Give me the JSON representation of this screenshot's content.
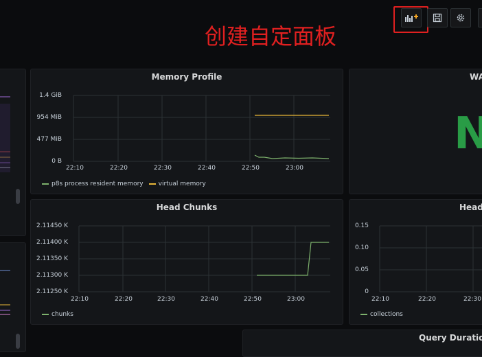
{
  "annotation": "创建自定面板",
  "toolbar": {
    "add_panel_icon": "add-panel-icon",
    "save_icon": "save-icon",
    "settings_icon": "gear-icon"
  },
  "colors": {
    "green": "#7eb26d",
    "yellow": "#eab839",
    "red": "#e02020",
    "stat_green": "#299c46"
  },
  "panels": {
    "memory": {
      "title": "Memory Profile",
      "yticks": [
        "1.4 GiB",
        "954 MiB",
        "477 MiB",
        "0 B"
      ],
      "xticks": [
        "22:10",
        "22:20",
        "22:30",
        "22:40",
        "22:50",
        "23:00"
      ],
      "legend": [
        "p8s process resident memory",
        "virtual memory"
      ]
    },
    "wal": {
      "title": "WA",
      "value": "N"
    },
    "head_chunks": {
      "title": "Head Chunks",
      "yticks": [
        "2.11450 K",
        "2.11400 K",
        "2.11350 K",
        "2.11300 K",
        "2.11250 K"
      ],
      "xticks": [
        "22:10",
        "22:20",
        "22:30",
        "22:40",
        "22:50",
        "23:00"
      ],
      "legend": [
        "chunks"
      ]
    },
    "head_b": {
      "title": "Head B",
      "yticks": [
        "0.15",
        "0.10",
        "0.05",
        "0"
      ],
      "xticks": [
        "22:10",
        "22:20",
        "22:30"
      ],
      "legend": [
        "collections"
      ]
    },
    "query": {
      "title": "Query Durations"
    }
  }
}
